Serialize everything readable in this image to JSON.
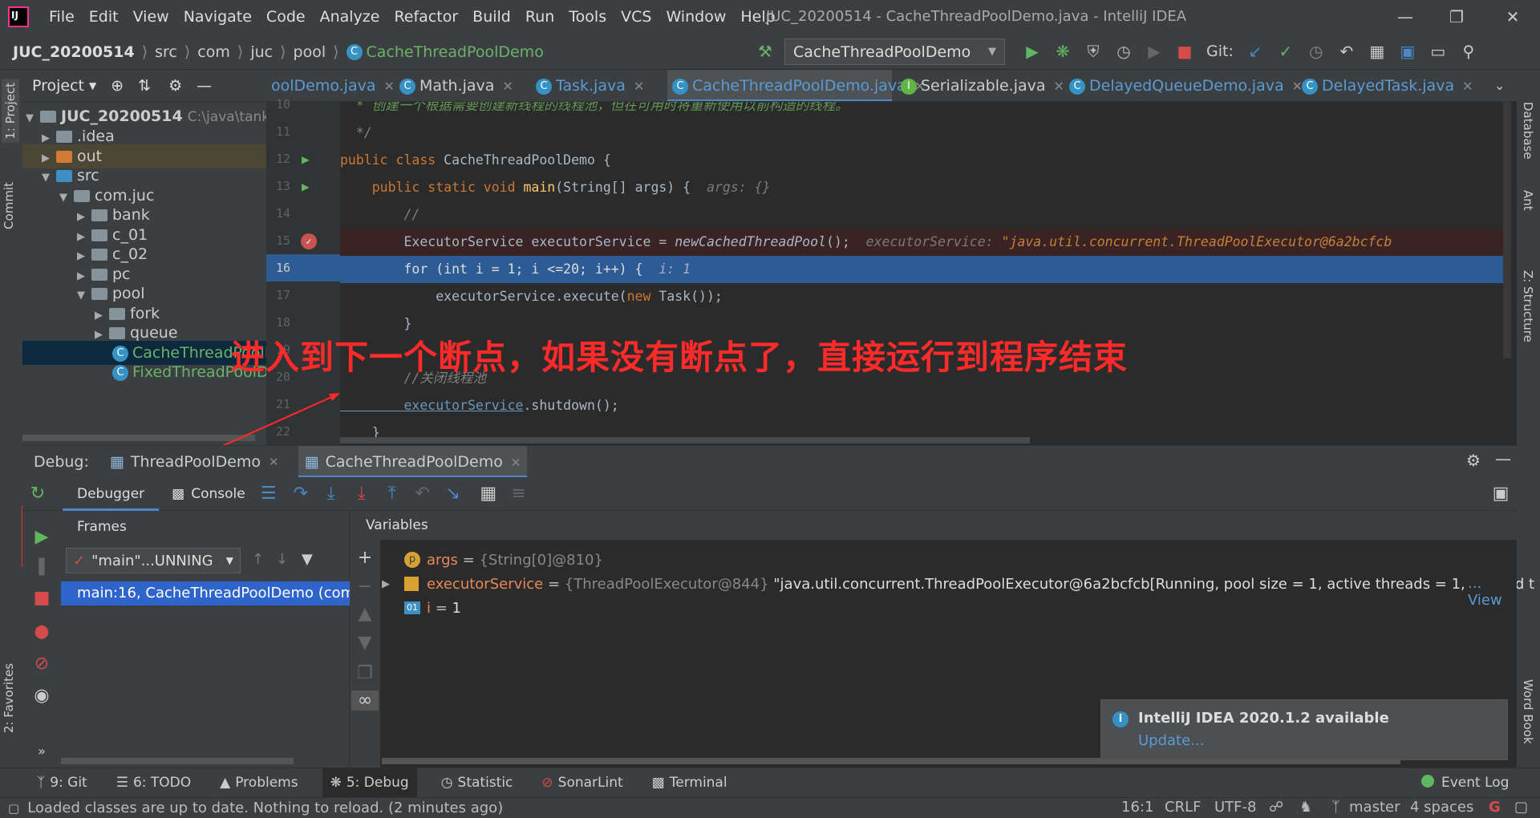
{
  "app": {
    "window_title": "JUC_20200514 - CacheThreadPoolDemo.java - IntelliJ IDEA",
    "menu": [
      "File",
      "Edit",
      "View",
      "Navigate",
      "Code",
      "Analyze",
      "Refactor",
      "Build",
      "Run",
      "Tools",
      "VCS",
      "Window",
      "Help"
    ]
  },
  "breadcrumb": [
    "JUC_20200514",
    "src",
    "com",
    "juc",
    "pool",
    "CacheThreadPoolDemo"
  ],
  "run_config": "CacheThreadPoolDemo",
  "git_label": "Git:",
  "left_strip": {
    "project": "1: Project",
    "commit": "Commit",
    "favorites": "2: Favorites"
  },
  "right_strip": {
    "database": "Database",
    "ant": "Ant",
    "structure": "Z: Structure",
    "wordbook": "Word Book"
  },
  "project": {
    "header": "Project",
    "root": "JUC_20200514",
    "root_path": "C:\\java\\tank",
    "nodes": [
      ".idea",
      "out",
      "src",
      "com.juc",
      "bank",
      "c_01",
      "c_02",
      "pc",
      "pool",
      "fork",
      "queue",
      "CacheThreadPoolDemo",
      "FixedThreadPoolDemo"
    ]
  },
  "editor_tabs": [
    {
      "label": "oolDemo.java",
      "icon": ""
    },
    {
      "label": "Math.java",
      "icon": "C"
    },
    {
      "label": "Task.java",
      "icon": "C"
    },
    {
      "label": "CacheThreadPoolDemo.java",
      "icon": "C"
    },
    {
      "label": "Serializable.java",
      "icon": "I"
    },
    {
      "label": "DelayedQueueDemo.java",
      "icon": "C"
    },
    {
      "label": "DelayedTask.java",
      "icon": "C"
    }
  ],
  "line_numbers": [
    "10",
    "11",
    "12",
    "13",
    "14",
    "15",
    "16",
    "17",
    "18",
    "19",
    "20",
    "21",
    "22"
  ],
  "code": {
    "l10": "  * 创建一个根据需要创建新线程的线程池，但在可用时将重新使用以前构造的线程。",
    "l11": "  */",
    "l12_kw": "public class ",
    "l12_name": "CacheThreadPoolDemo {",
    "l13_kw": "    public static void ",
    "l13_fn": "main",
    "l13_rest": "(String[] args) {  ",
    "l13_hint": "args: {}",
    "l14": "        //",
    "l15_a": "        ExecutorService executorService = ",
    "l15_fn": "newCachedThreadPool",
    "l15_b": "();  ",
    "l15_hint": "executorService: ",
    "l15_hintv": "\"java.util.concurrent.ThreadPoolExecutor@6a2bcfcb",
    "l16_a": "        for (int i = 1; i <=20; i++) {  ",
    "l16_hint": "i: 1",
    "l17_a": "            executorService.execute(",
    "l17_kw": "new ",
    "l17_b": "Task());",
    "l18": "        }",
    "l20": "        //关闭线程池",
    "l21_a": "        executorService",
    "l21_b": ".shutdown();",
    "l22": "    }"
  },
  "annotation": "进入到下一个断点，如果没有断点了，直接运行到程序结束",
  "debug": {
    "label": "Debug:",
    "tabs": [
      "ThreadPoolDemo",
      "CacheThreadPoolDemo"
    ],
    "debugger_tab": "Debugger",
    "console_tab": "Console",
    "frames_title": "Frames",
    "thread": "\"main\"...UNNING",
    "frame": "main:16, CacheThreadPoolDemo (com.",
    "variables_title": "Variables"
  },
  "variables": [
    {
      "icon": "p",
      "name": "args",
      "eq": " = ",
      "type": "{String[0]@810}",
      "value": ""
    },
    {
      "icon": "list",
      "name": "executorService",
      "eq": " = ",
      "type": "{ThreadPoolExecutor@844}",
      "value": " \"java.util.concurrent.ThreadPoolExecutor@6a2bcfcb[Running, pool size = 1, active threads = 1, queued t"
    },
    {
      "icon": "01",
      "name": "i",
      "eq": " = ",
      "type": "1",
      "value": ""
    }
  ],
  "view_link": "... View",
  "notification": {
    "title": "IntelliJ IDEA 2020.1.2 available",
    "link": "Update..."
  },
  "toolwindows": [
    "9: Git",
    "6: TODO",
    "Problems",
    "5: Debug",
    "Statistic",
    "SonarLint",
    "Terminal"
  ],
  "event_log": "Event Log",
  "status": {
    "message": "Loaded classes are up to date. Nothing to reload. (2 minutes ago)",
    "position": "16:1",
    "line_sep": "CRLF",
    "encoding": "UTF-8",
    "branch": "master",
    "indent": "4 spaces"
  },
  "colors": {
    "accent": "#4a88c7",
    "selection": "#2d5c95",
    "annotation": "#ff2a2a",
    "breakpoint_line": "#3a2323"
  }
}
